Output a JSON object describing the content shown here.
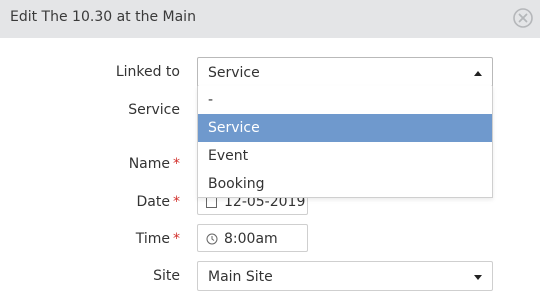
{
  "dialog": {
    "title": "Edit The 10.30 at the Main",
    "close_icon": "close-circle-icon"
  },
  "form": {
    "linked_to": {
      "label": "Linked to",
      "value": "Service",
      "options": [
        "-",
        "Service",
        "Event",
        "Booking"
      ],
      "selected_index": 1
    },
    "service": {
      "label": "Service"
    },
    "name": {
      "label": "Name",
      "required_mark": "*"
    },
    "date": {
      "label": "Date",
      "required_mark": "*",
      "value": "12-05-2019",
      "icon": "calendar-icon"
    },
    "time": {
      "label": "Time",
      "required_mark": "*",
      "value": "8:00am",
      "icon": "clock-icon"
    },
    "site": {
      "label": "Site",
      "value": "Main Site"
    }
  },
  "colors": {
    "header_bg": "#e4e5e7",
    "selected_option_bg": "#6f99cd",
    "required": "#d2302c"
  }
}
